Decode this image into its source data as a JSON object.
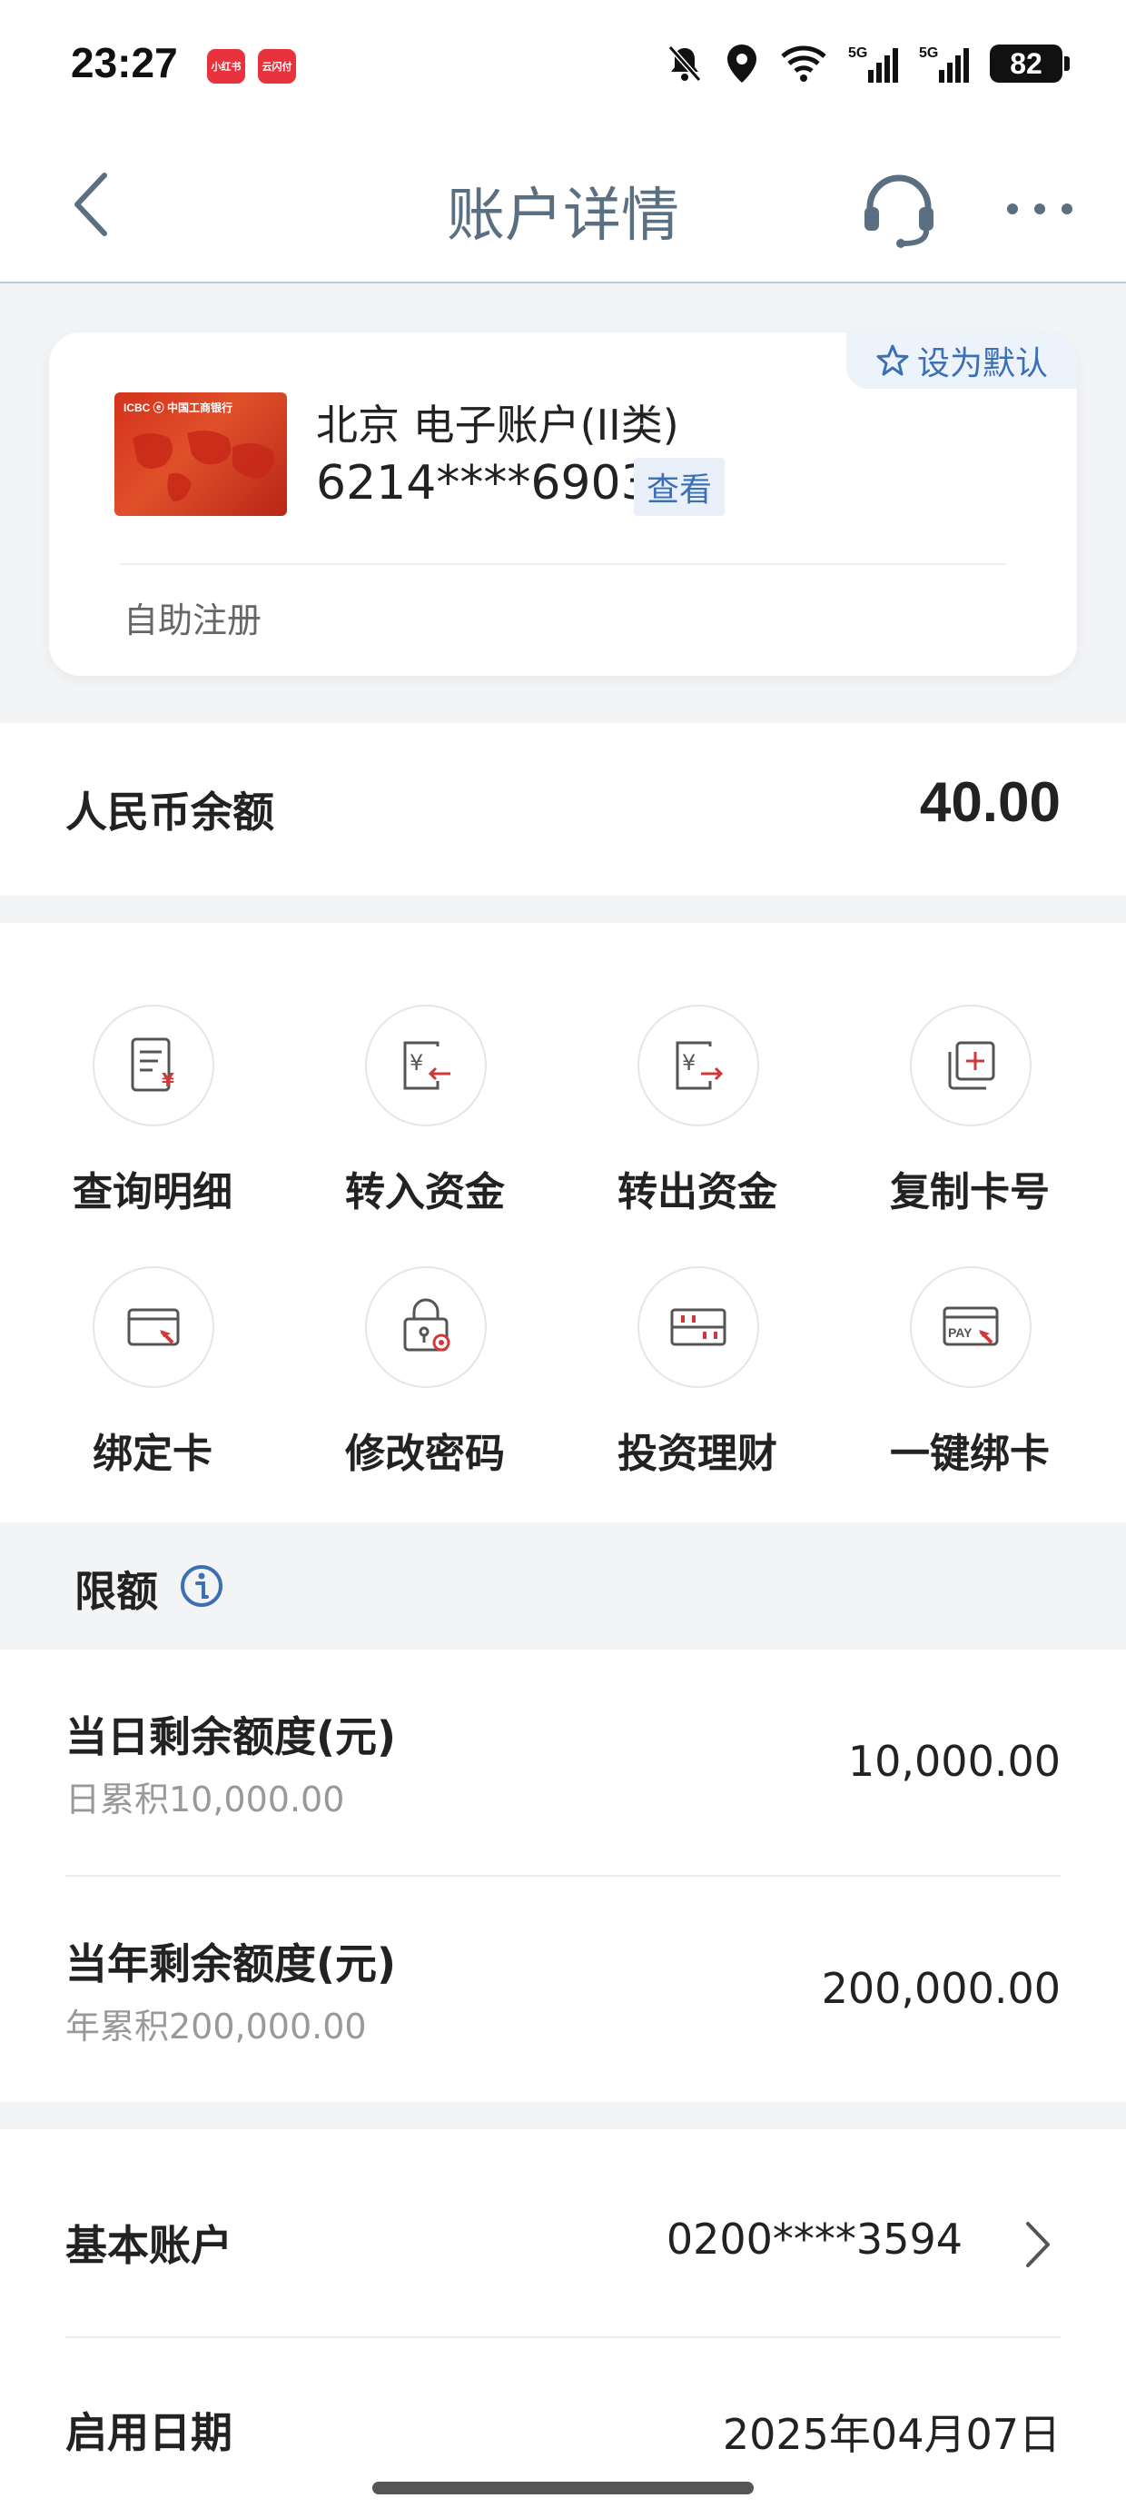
{
  "status_bar": {
    "time": "23:27",
    "app_badges": [
      "小红书",
      "云闪付"
    ],
    "battery": "82",
    "network": [
      "5G",
      "5G"
    ]
  },
  "nav": {
    "title": "账户详情",
    "back_icon": "chevron-left-icon",
    "service_icon": "headset-icon",
    "more_icon": "more-icon"
  },
  "account_card": {
    "set_default_label": "设为默认",
    "card_image_text": "ICBC ⓔ 中国工商银行",
    "name": "北京 电子账户(II类)",
    "number": "6214****6903",
    "view_label": "查看",
    "source": "自助注册"
  },
  "balance": {
    "label": "人民币余额",
    "value": "40.00"
  },
  "functions": [
    {
      "label": "查询明细",
      "icon": "statement-icon"
    },
    {
      "label": "转入资金",
      "icon": "transfer-in-icon"
    },
    {
      "label": "转出资金",
      "icon": "transfer-out-icon"
    },
    {
      "label": "复制卡号",
      "icon": "copy-icon"
    },
    {
      "label": "绑定卡",
      "icon": "bind-card-icon"
    },
    {
      "label": "修改密码",
      "icon": "lock-settings-icon"
    },
    {
      "label": "投资理财",
      "icon": "abacus-icon"
    },
    {
      "label": "一键绑卡",
      "icon": "pay-card-icon"
    }
  ],
  "limits": {
    "title": "限额",
    "daily": {
      "label": "当日剩余额度(元)",
      "sub": "日累积10,000.00",
      "value": "10,000.00"
    },
    "yearly": {
      "label": "当年剩余额度(元)",
      "sub": "年累积200,000.00",
      "value": "200,000.00"
    }
  },
  "basic_account": {
    "label": "基本账户",
    "value": "0200****3594"
  },
  "start_date": {
    "label": "启用日期",
    "value": "2025年04月07日"
  },
  "colors": {
    "accent_blue": "#3b6fb6",
    "nav_title": "#5b6f82",
    "icon_red": "#d0383a",
    "background_gray": "#f3f4f6"
  }
}
